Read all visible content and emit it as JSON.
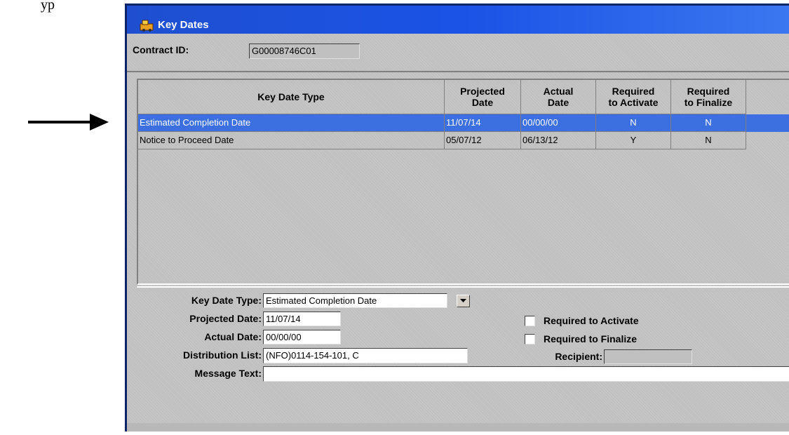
{
  "document": {
    "caption": "yp"
  },
  "window": {
    "title": "Key Dates"
  },
  "header": {
    "contract_label": "Contract ID:",
    "contract_value": "G00008746C01"
  },
  "grid": {
    "columns": [
      {
        "l1": "Key Date Type",
        "l2": ""
      },
      {
        "l1": "Projected",
        "l2": "Date"
      },
      {
        "l1": "Actual",
        "l2": "Date"
      },
      {
        "l1": "Required",
        "l2": "to Activate"
      },
      {
        "l1": "Required",
        "l2": "to Finalize"
      }
    ],
    "rows": [
      {
        "type": "Estimated Completion Date",
        "projected": "11/07/14",
        "actual": "00/00/00",
        "activate": "N",
        "finalize": "N"
      },
      {
        "type": "Notice to Proceed Date",
        "projected": "05/07/12",
        "actual": "06/13/12",
        "activate": "Y",
        "finalize": "N"
      }
    ]
  },
  "detail": {
    "key_date_type_label": "Key Date Type:",
    "key_date_type_value": "Estimated Completion Date",
    "projected_label": "Projected Date:",
    "projected_value": "11/07/14",
    "actual_label": "Actual Date:",
    "actual_value": "00/00/00",
    "distribution_label": "Distribution List:",
    "distribution_value": "(NFO)0114-154-101, C",
    "message_label": "Message Text:",
    "message_value": "",
    "req_activate_label": "Required to Activate",
    "req_finalize_label": "Required to Finalize",
    "recipient_label": "Recipient:",
    "recipient_value": ""
  },
  "colors": {
    "selection": "#3c6fe0",
    "titlebar": "#1a53e6",
    "panel": "#c0c0c0"
  }
}
